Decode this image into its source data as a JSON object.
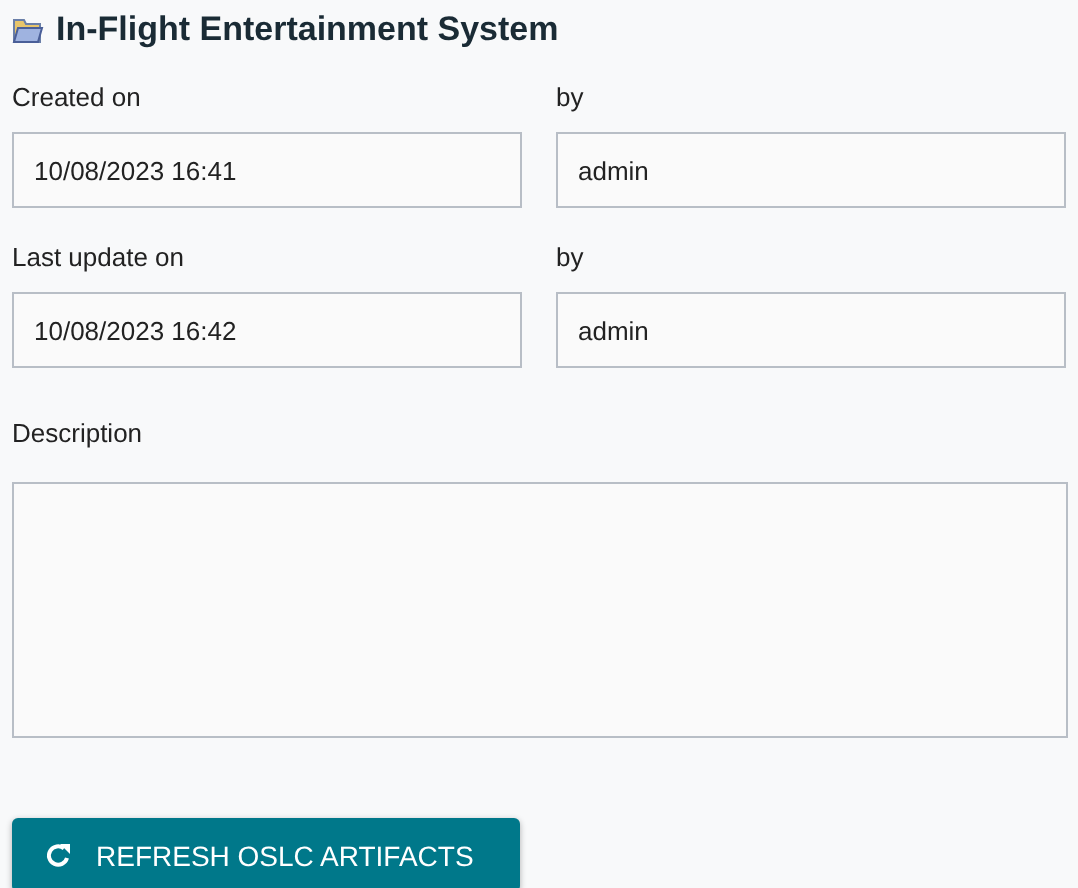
{
  "title": "In-Flight Entertainment System",
  "rows": [
    [
      {
        "label": "Created on",
        "value": "10/08/2023 16:41"
      },
      {
        "label": "by",
        "value": "admin"
      }
    ],
    [
      {
        "label": "Last update on",
        "value": "10/08/2023 16:42"
      },
      {
        "label": "by",
        "value": "admin"
      }
    ]
  ],
  "description": {
    "label": "Description"
  },
  "button": {
    "label": "REFRESH OSLC ARTIFACTS"
  }
}
